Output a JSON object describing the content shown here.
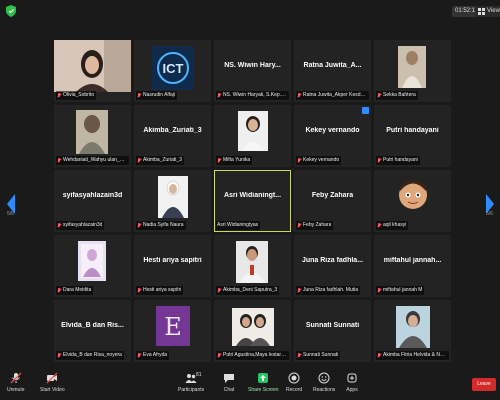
{
  "topbar": {
    "timer": "01:52:14",
    "view_label": "View"
  },
  "pages": {
    "left": "5/6",
    "right": "5/6"
  },
  "tiles": [
    {
      "label": "Olivia_Sobrito",
      "name": "",
      "photo": true
    },
    {
      "label": "Nasrudin Alfaji",
      "name": "",
      "photo": true
    },
    {
      "label": "NS. Wiwin Haryati, S.Kep., M...",
      "name": "NS. Wiwin Hary..."
    },
    {
      "label": "Ratna Juwita_Akper Kesdam I...",
      "name": "Ratna Juwita_A..."
    },
    {
      "label": "Sekka Bahtera",
      "name": "",
      "photo": true
    },
    {
      "label": "Wehdaniati_Wahyu ulan_Mifta...",
      "name": "",
      "photo": true
    },
    {
      "label": "Akimba_Zuriati_3",
      "name": "Akimba_Zuriati_3"
    },
    {
      "label": "Mifta Yunika",
      "name": "",
      "photo": true
    },
    {
      "label": "Kekey vernando",
      "name": "Kekey vernando"
    },
    {
      "label": "Putri handayani",
      "name": "Putri handayani"
    },
    {
      "label": "syifasyahlazain3d",
      "name": "syifasyahlazain3d"
    },
    {
      "label": "Nadia Syifa Naura",
      "name": "",
      "photo": true
    },
    {
      "label": "Asri Widianingtyas",
      "name": "Asri Widianingt..."
    },
    {
      "label": "Feby Zahara",
      "name": "Feby Zahara"
    },
    {
      "label": "aqil khasyi",
      "name": "",
      "photo": true
    },
    {
      "label": "Dara Meidita",
      "name": "",
      "photo": true
    },
    {
      "label": "Hesti ariya sapitri",
      "name": "Hesti ariya sapitri"
    },
    {
      "label": "Akimba_Deni Saputra_3",
      "name": "",
      "photo": true
    },
    {
      "label": "Juna Riza fadhlah. Mutia",
      "name": "Juna Riza fadhla..."
    },
    {
      "label": "miftahul jannah M",
      "name": "miftahul jannah..."
    },
    {
      "label": "Elvida_B dan Risa_noyera",
      "name": "Elvida_B dan Ris..."
    },
    {
      "label": "Eva Afryda",
      "name": "",
      "photo": true
    },
    {
      "label": "Putri Agustina,Maya lestari da...",
      "name": "",
      "photo": true
    },
    {
      "label": "Sunnati Sunnati",
      "name": "Sunnati Sunnati"
    },
    {
      "label": "Akimba Fitria Helvida & Nurul...",
      "name": "",
      "photo": true
    }
  ],
  "toolbar": {
    "unmute": "Unmute",
    "start_video": "Start Video",
    "participants": "Participants",
    "participants_count": "81",
    "chat": "Chat",
    "share_screen": "Share Screen",
    "record": "Record",
    "reactions": "Reactions",
    "apps": "Apps",
    "leave": "Leave"
  },
  "colors": {
    "active_speaker": "#c9d66a",
    "share_green": "#22c55e",
    "leave_red": "#d32a2a",
    "muted_red": "#ff5a5a"
  }
}
